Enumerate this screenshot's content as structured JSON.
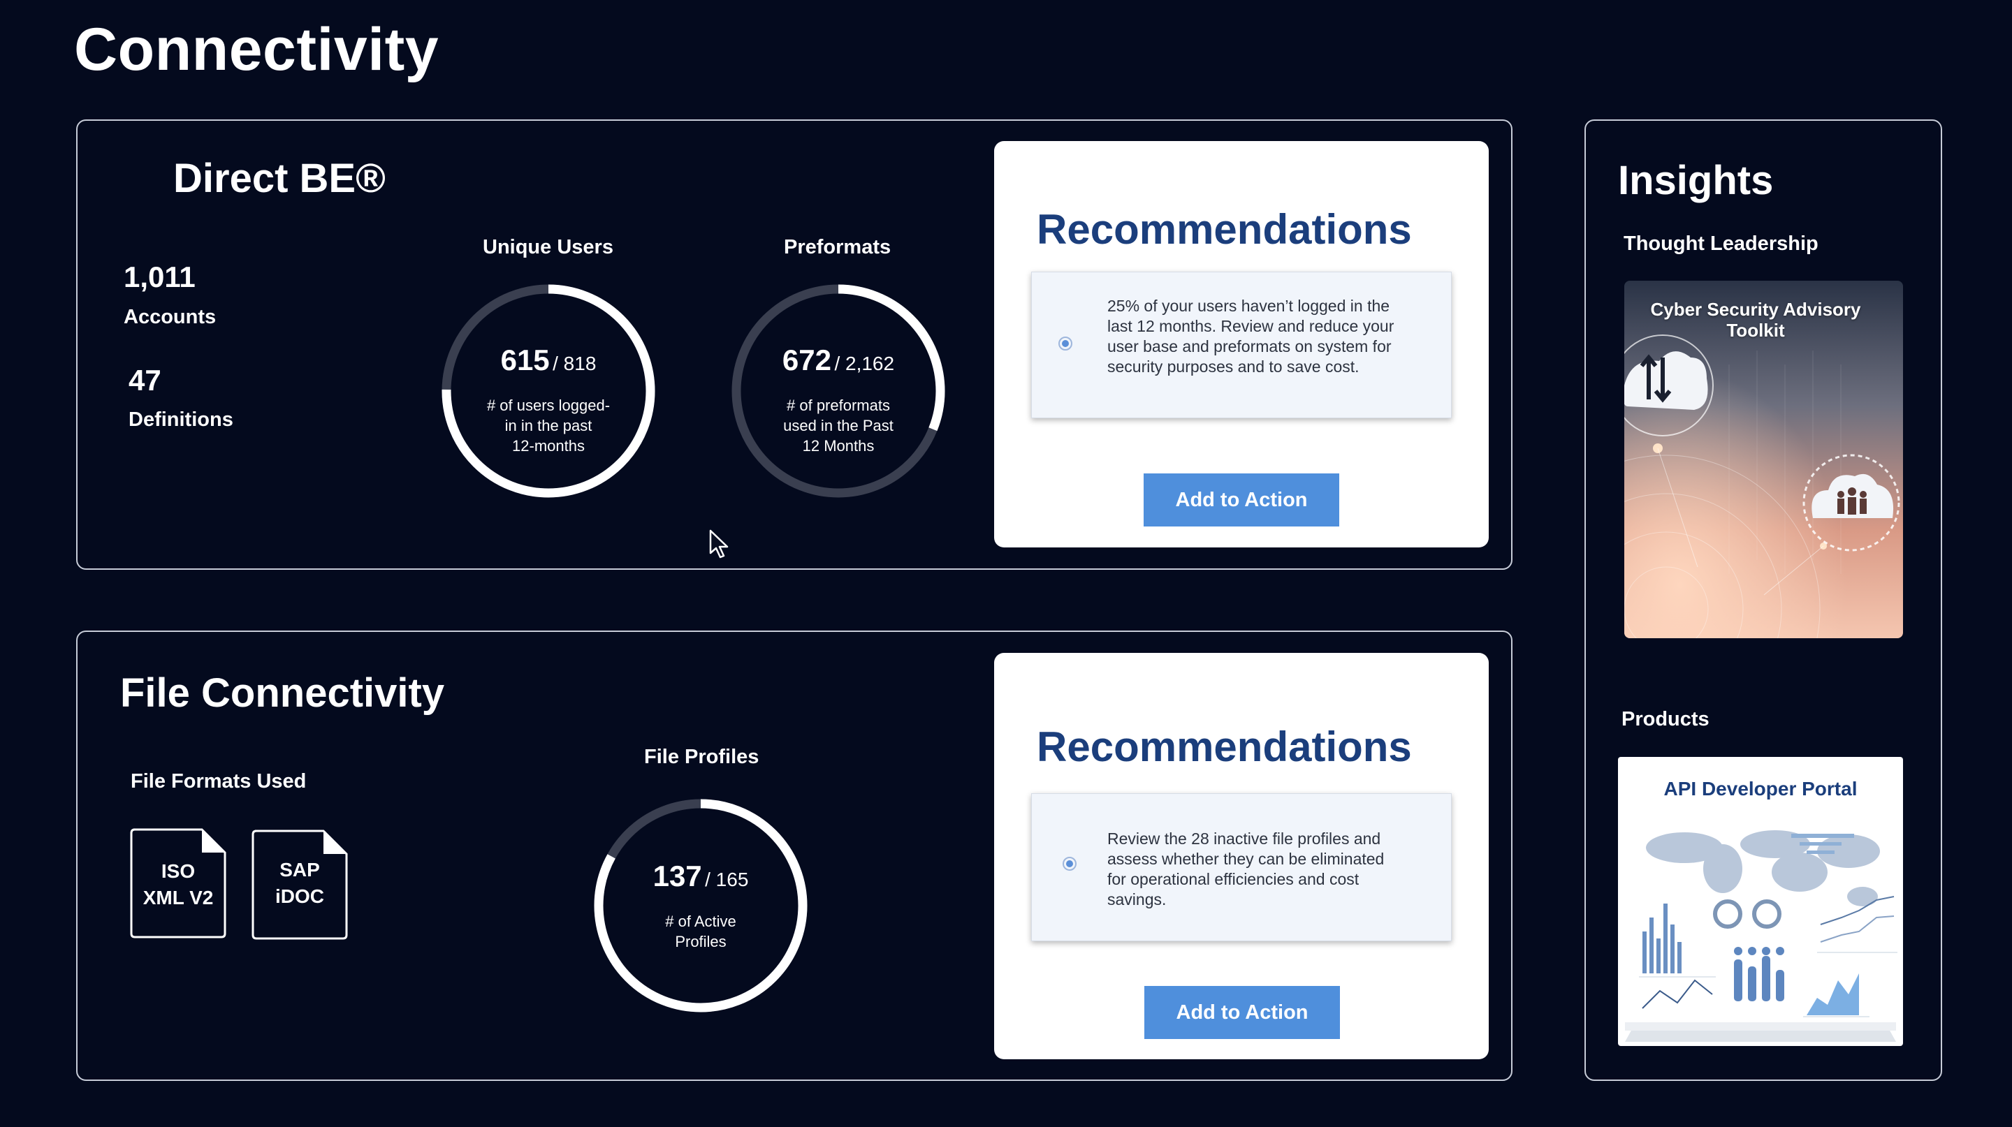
{
  "page": {
    "title": "Connectivity"
  },
  "direct_be": {
    "title": "Direct BE®",
    "accounts": {
      "value": "1,011",
      "label": "Accounts"
    },
    "definitions": {
      "value": "47",
      "label": "Definitions"
    },
    "unique_users": {
      "title": "Unique Users",
      "value": "615",
      "total": "/ 818",
      "fraction": 0.752,
      "desc": [
        "# of users logged-",
        "in in the past",
        "12-months"
      ]
    },
    "preformats": {
      "title": "Preformats",
      "value": "672",
      "total": "/ 2,162",
      "fraction": 0.311,
      "desc": [
        "# of preformats",
        "used in the Past",
        "12 Months"
      ]
    },
    "recommendation": {
      "title": "Recommendations",
      "text": [
        "25% of your users haven’t logged in the",
        "last 12 months. Review and reduce your",
        "user base and preformats on system for",
        "security purposes and to save cost."
      ],
      "button": "Add to Action"
    }
  },
  "file_connectivity": {
    "title": "File Connectivity",
    "formats_title": "File Formats Used",
    "formats": [
      {
        "line1": "ISO",
        "line2": "XML V2"
      },
      {
        "line1": "SAP",
        "line2": "iDOC"
      }
    ],
    "profiles": {
      "title": "File Profiles",
      "value": "137",
      "total": "/ 165",
      "fraction": 0.83,
      "desc": [
        "# of Active",
        "Profiles"
      ]
    },
    "recommendation": {
      "title": "Recommendations",
      "text": [
        "Review the 28 inactive file profiles and",
        "assess whether they can be eliminated",
        "for operational efficiencies and cost",
        "savings."
      ],
      "button": "Add to Action"
    }
  },
  "insights": {
    "title": "Insights",
    "thought_leadership": {
      "title": "Thought Leadership",
      "card_title_lines": [
        "Cyber Security Advisory",
        "Toolkit"
      ]
    },
    "products": {
      "title": "Products",
      "card_title": "API Developer Portal"
    }
  },
  "colors": {
    "background": "#040a1e",
    "ring_fill": "#ffffff",
    "ring_track": "#3a3f50",
    "recommendation_title": "#1b3e7c",
    "button": "#4f8fdc"
  }
}
